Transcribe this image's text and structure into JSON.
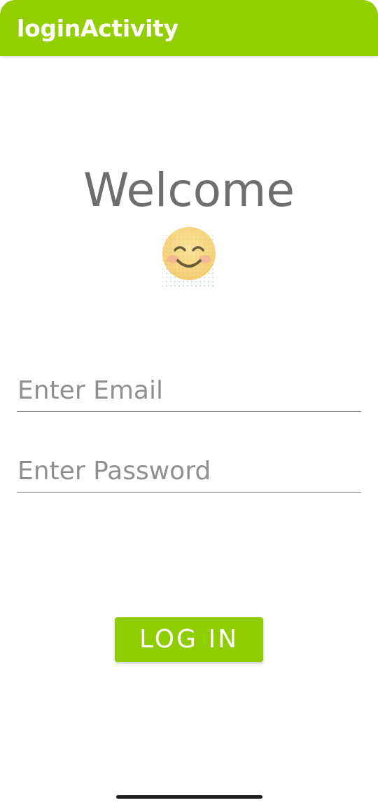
{
  "app_bar": {
    "title": "loginActivity",
    "color": "#93ce00"
  },
  "main": {
    "welcome_text": "Welcome",
    "emoji_icon": "smiling-face-icon"
  },
  "form": {
    "email_placeholder": "Enter Email",
    "email_value": "",
    "password_placeholder": "Enter Password",
    "password_value": ""
  },
  "login_button": {
    "label": "LOG IN",
    "color": "#8fcc00"
  }
}
